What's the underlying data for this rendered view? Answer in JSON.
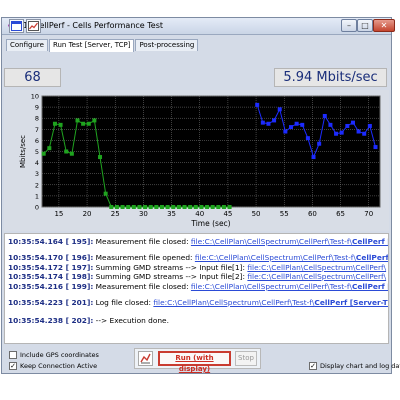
{
  "window": {
    "title": "[1] CellPerf - Cells Performance Test",
    "controls": {
      "minimize": "–",
      "maximize": "□",
      "close": "✕"
    }
  },
  "tabs": [
    {
      "label": "Configure"
    },
    {
      "label": "Run Test [Server, TCP]",
      "active": true
    },
    {
      "label": "Post-processing"
    }
  ],
  "toolbar": {
    "icons": [
      "window-icon",
      "chart-edit-icon"
    ]
  },
  "stats": {
    "count": "68",
    "rate": "5.94 Mbits/sec"
  },
  "chart_data": {
    "type": "line",
    "ylabel": "Mbits/sec",
    "xlabel": "Time (sec)",
    "xlim": [
      12,
      72
    ],
    "ylim": [
      0,
      10
    ],
    "x_ticks": [
      15,
      20,
      25,
      30,
      35,
      40,
      45,
      50,
      55,
      60,
      65,
      70
    ],
    "y_ticks": [
      0,
      1,
      2,
      3,
      4,
      5,
      6,
      7,
      8,
      9,
      10
    ],
    "grid": true,
    "background": "#000000",
    "grid_color": "#7f7f7f",
    "series": [
      {
        "color": "#1fa31f",
        "points": [
          [
            12.3,
            4.8
          ],
          [
            13.3,
            5.3
          ],
          [
            14.3,
            7.5
          ],
          [
            15.3,
            7.4
          ],
          [
            16.3,
            5.0
          ],
          [
            17.3,
            4.8
          ],
          [
            18.3,
            7.8
          ],
          [
            19.3,
            7.5
          ],
          [
            20.3,
            7.5
          ],
          [
            21.3,
            7.8
          ],
          [
            22.3,
            4.5
          ],
          [
            23.3,
            1.2
          ],
          [
            24.3,
            0
          ],
          [
            25.3,
            0
          ],
          [
            26.3,
            0
          ],
          [
            27.3,
            0
          ],
          [
            28.3,
            0
          ],
          [
            29.3,
            0
          ],
          [
            30.3,
            0
          ],
          [
            31.3,
            0
          ],
          [
            32.3,
            0
          ],
          [
            33.3,
            0
          ],
          [
            34.3,
            0
          ],
          [
            35.3,
            0
          ],
          [
            36.3,
            0
          ],
          [
            37.3,
            0
          ],
          [
            38.3,
            0
          ],
          [
            39.3,
            0
          ],
          [
            40.3,
            0
          ],
          [
            41.3,
            0
          ],
          [
            42.3,
            0
          ],
          [
            43.3,
            0
          ],
          [
            44.3,
            0
          ],
          [
            45.3,
            0
          ]
        ]
      },
      {
        "color": "#1c2bff",
        "points": [
          [
            50.2,
            9.2
          ],
          [
            51.2,
            7.6
          ],
          [
            52.2,
            7.5
          ],
          [
            53.2,
            7.8
          ],
          [
            54.2,
            8.8
          ],
          [
            55.2,
            6.8
          ],
          [
            56.2,
            7.2
          ],
          [
            57.2,
            7.5
          ],
          [
            58.2,
            7.4
          ],
          [
            59.2,
            6.2
          ],
          [
            60.2,
            4.5
          ],
          [
            61.2,
            5.7
          ],
          [
            62.2,
            8.2
          ],
          [
            63.2,
            7.4
          ],
          [
            64.2,
            6.6
          ],
          [
            65.2,
            6.7
          ],
          [
            66.2,
            7.3
          ],
          [
            67.2,
            7.6
          ],
          [
            68.2,
            6.8
          ],
          [
            69.2,
            6.6
          ],
          [
            70.2,
            7.3
          ],
          [
            71.2,
            5.4
          ]
        ]
      }
    ]
  },
  "log": [
    {
      "ts": "10:35:54.164 [ 195]:",
      "text": " Measurement file closed: ",
      "link": "file:C:\\CellPlan\\CellSpectrum\\CellPerf\\Test-f\\",
      "bold_link": "CellPerf [Server-"
    },
    {
      "ts": "10:35:54.170 [ 196]:",
      "text": " Measurement file opened: ",
      "link": "file:C:\\CellPlan\\CellSpectrum\\CellPerf\\Test-f\\",
      "bold_link": "CellPerf [Serve"
    },
    {
      "ts": "10:35:54.172 [ 197]:",
      "text": " Summing GMD streams --> Input file[1]: ",
      "link": "file:C:\\CellPlan\\CellSpectrum\\CellPerf\\",
      "bold_link": ""
    },
    {
      "ts": "10:35:54.174 [ 198]:",
      "text": " Summing GMD streams --> Input file[2]: ",
      "link": "file:C:\\CellPlan\\CellSpectrum\\CellPerf\\",
      "bold_link": ""
    },
    {
      "ts": "10:35:54.216 [ 199]:",
      "text": " Measurement file closed: ",
      "link": "file:C:\\CellPlan\\CellSpectrum\\CellPerf\\Test-f\\",
      "bold_link": "CellPerf [Serve"
    },
    {
      "ts": "10:35:54.223 [ 201]:",
      "text": " Log file closed: ",
      "link": "file:C:\\CellPlan\\CellSpectrum\\CellPerf\\Test-f\\",
      "bold_link": "CellPerf [Server-TCP] --L"
    },
    {
      "ts": "10:35:54.238 [ 202]:",
      "text": " --> Execution done.",
      "link": "",
      "bold_link": ""
    }
  ],
  "bottom": {
    "gps_label": "Include GPS coordinates",
    "gps_checked": false,
    "keep_label": "Keep Connection Active",
    "keep_checked": true,
    "run_label": "Run (with display)",
    "stop_label": "Stop",
    "display_label": "Display chart and log data",
    "display_checked": true
  },
  "colors": {
    "accent": "#1e2f85",
    "run": "#cc2d22",
    "link": "#2b4bd6"
  }
}
